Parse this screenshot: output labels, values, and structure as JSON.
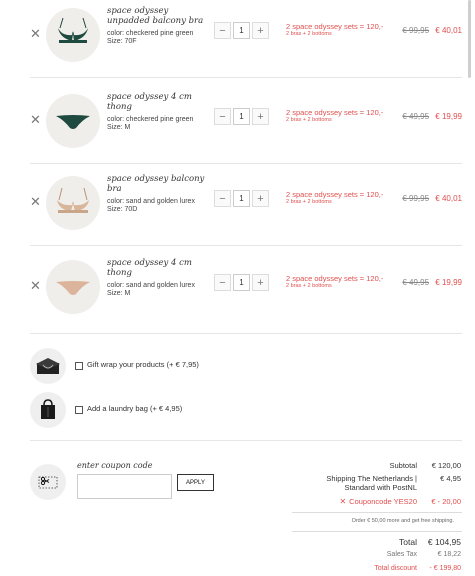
{
  "cart": {
    "items": [
      {
        "name": "space odyssey unpadded balcony bra",
        "color": "color: checkered pine green",
        "size": "Size: 70F",
        "qty": "1",
        "promo": "2 space odyssey sets = 120,-",
        "promo_sub": "2 bras + 2 bottoms",
        "old_price": "€ 99,95",
        "new_price": "€ 40,01"
      },
      {
        "name": "space odyssey 4 cm thong",
        "color": "color: checkered pine green",
        "size": "Size: M",
        "qty": "1",
        "promo": "2 space odyssey sets = 120,-",
        "promo_sub": "2 bras + 2 bottoms",
        "old_price": "€ 49,95",
        "new_price": "€ 19,99"
      },
      {
        "name": "space odyssey balcony bra",
        "color": "color: sand and golden lurex",
        "size": "Size: 70D",
        "qty": "1",
        "promo": "2 space odyssey sets = 120,-",
        "promo_sub": "2 bras + 2 bottoms",
        "old_price": "€ 99,95",
        "new_price": "€ 40,01"
      },
      {
        "name": "space odyssey 4 cm thong",
        "color": "color: sand and golden lurex",
        "size": "Size: M",
        "qty": "1",
        "promo": "2 space odyssey sets = 120,-",
        "promo_sub": "2 bras + 2 bottoms",
        "old_price": "€ 49,95",
        "new_price": "€ 19,99"
      }
    ],
    "remove_symbol": "✕",
    "minus_symbol": "−",
    "plus_symbol": "+"
  },
  "addons": {
    "gift_wrap": "Gift wrap your products (+ € 7,95)",
    "laundry_bag": "Add a laundry bag (+ € 4,95)"
  },
  "coupon": {
    "label": "enter coupon code",
    "value": "",
    "apply": "APPLY"
  },
  "summary": {
    "subtotal_label": "Subtotal",
    "subtotal": "€ 120,00",
    "shipping_label_1": "Shipping The Netherlands |",
    "shipping_label_2": "Standard with PostNL",
    "shipping": "€ 4,95",
    "coupon_label": "Couponcode YES20",
    "coupon_value": "€ - 20,00",
    "free_shipping_note": "Order € 50,00 more and get free shipping.",
    "total_label": "Total",
    "total": "€ 104,95",
    "tax_label": "Sales Tax",
    "tax": "€ 18,22",
    "discount_label": "Total discount",
    "discount": "- € 199,80"
  },
  "colors": {
    "accent_red": "#e0504e",
    "pine_green": "#1f4a3f",
    "sand": "#d9b59a"
  },
  "icons": {
    "remove": "close-icon",
    "gift": "gift-box-icon",
    "laundry": "laundry-bag-icon",
    "coupon": "scissors-coupon-icon"
  }
}
